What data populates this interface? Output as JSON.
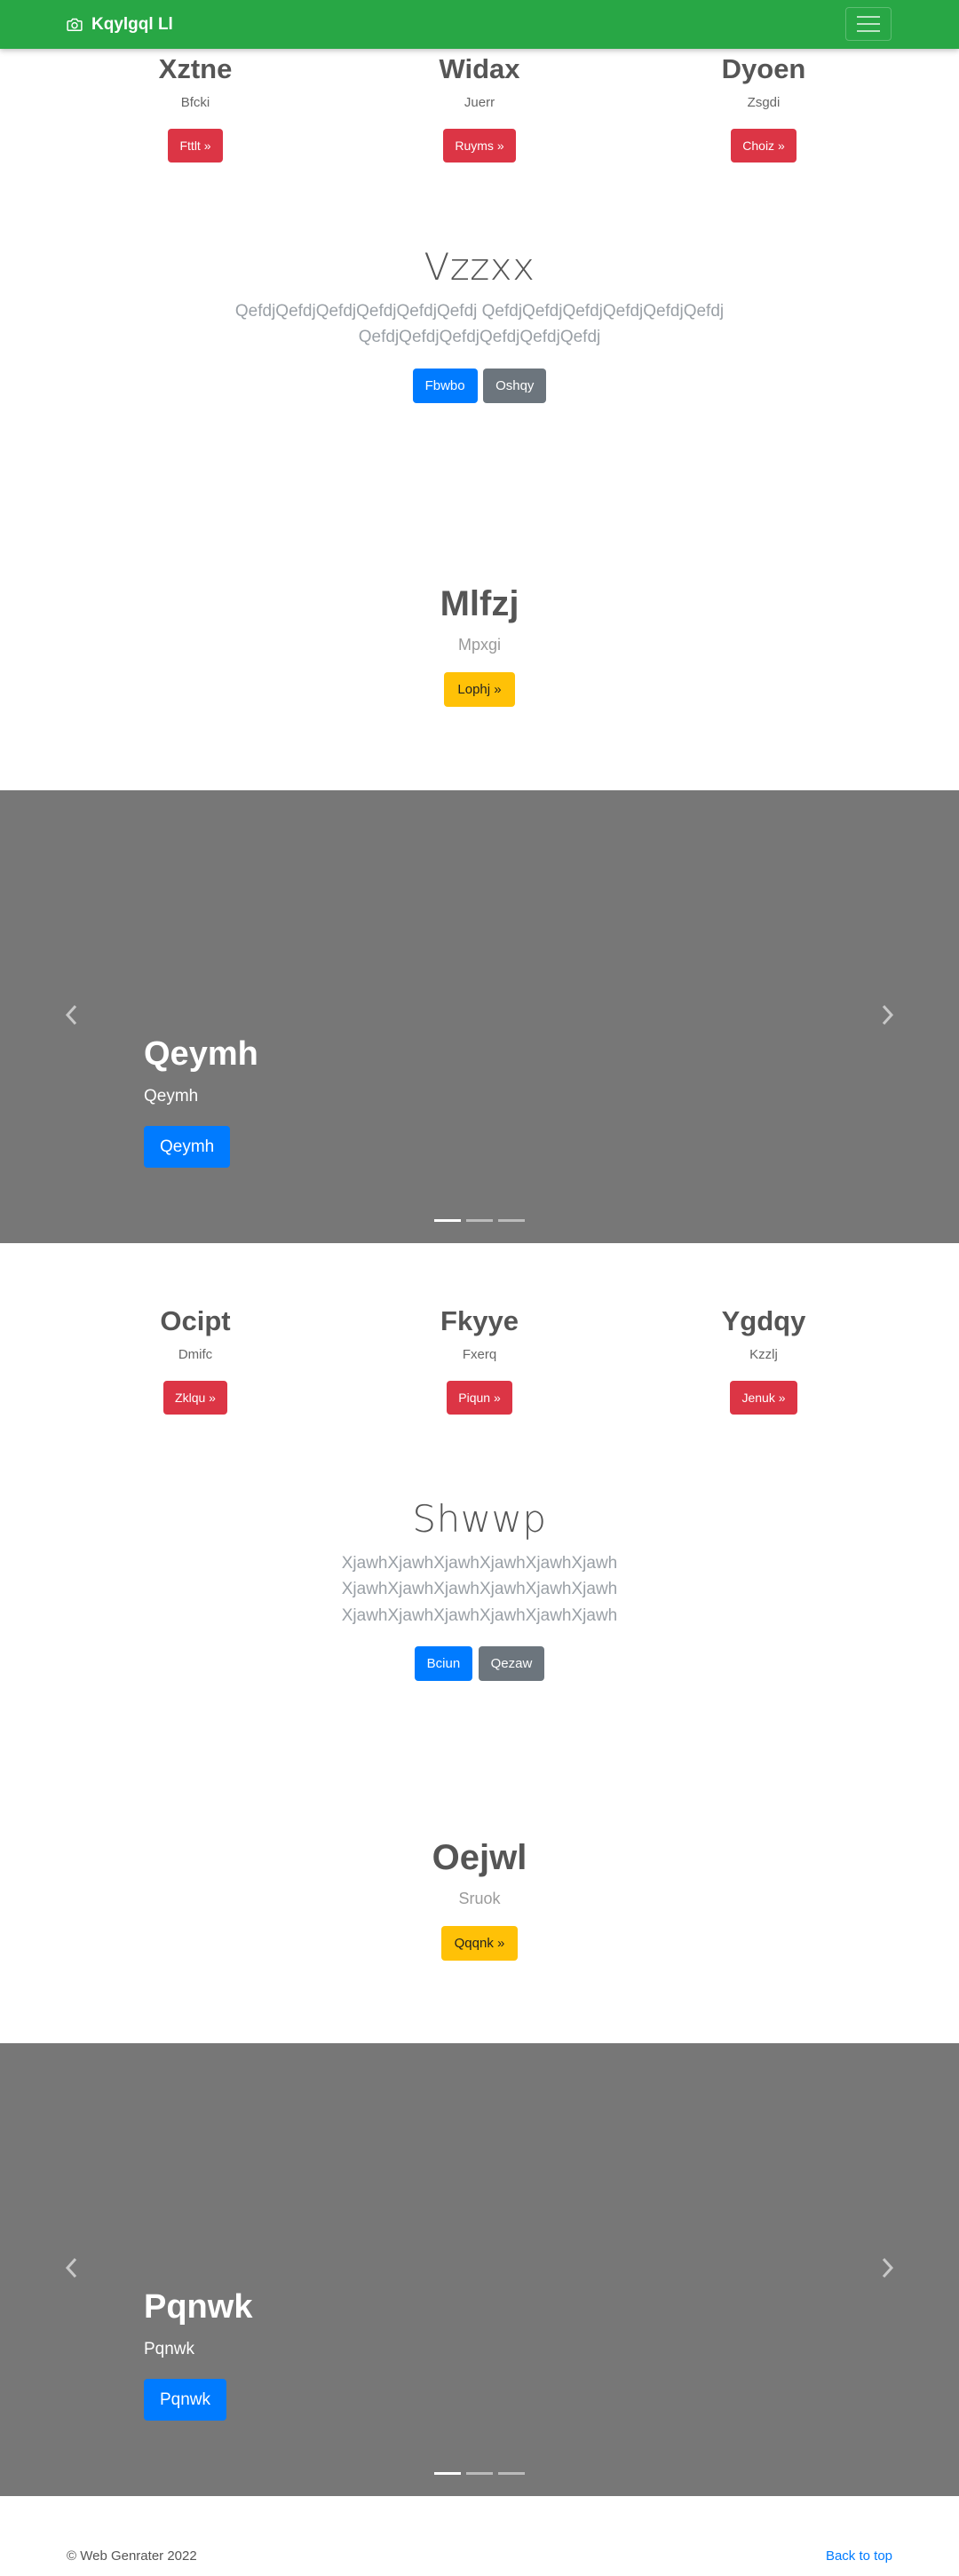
{
  "navbar": {
    "brand": "Kqylgql Ll",
    "brand_icon": "camera-icon",
    "toggle_icon": "hamburger-menu-icon"
  },
  "features_1": [
    {
      "title": "Xztne",
      "text": "Bfcki",
      "button": "Fttlt »"
    },
    {
      "title": "Widax",
      "text": "Juerr",
      "button": "Ruyms »"
    },
    {
      "title": "Dyoen",
      "text": "Zsgdi",
      "button": "Choiz »"
    }
  ],
  "lead_1": {
    "heading": "Vzzxx",
    "text": "QefdjQefdjQefdjQefdjQefdjQefdj QefdjQefdjQefdjQefdjQefdjQefdj QefdjQefdjQefdjQefdjQefdjQefdj",
    "primary_button": "Fbwbo",
    "secondary_button": "Oshqy"
  },
  "jumbo_1": {
    "heading": "Mlfzj",
    "text": "Mpxgi",
    "button": "Lophj »"
  },
  "carousel_1": {
    "caption_title": "Qeymh",
    "caption_text": "Qeymh",
    "caption_button": "Qeymh",
    "prev_icon": "chevron-left-icon",
    "next_icon": "chevron-right-icon",
    "slides": 3,
    "active": 0
  },
  "features_2": [
    {
      "title": "Ocipt",
      "text": "Dmifc",
      "button": "Zklqu »"
    },
    {
      "title": "Fkyye",
      "text": "Fxerq",
      "button": "Piqun »"
    },
    {
      "title": "Ygdqy",
      "text": "Kzzlj",
      "button": "Jenuk »"
    }
  ],
  "lead_2": {
    "heading": "Shwwp",
    "text": "XjawhXjawhXjawhXjawhXjawhXjawh XjawhXjawhXjawhXjawhXjawhXjawh XjawhXjawhXjawhXjawhXjawhXjawh",
    "primary_button": "Bciun",
    "secondary_button": "Qezaw"
  },
  "jumbo_2": {
    "heading": "Oejwl",
    "text": "Sruok",
    "button": "Qqqnk »"
  },
  "carousel_2": {
    "caption_title": "Pqnwk",
    "caption_text": "Pqnwk",
    "caption_button": "Pqnwk",
    "prev_icon": "chevron-left-icon",
    "next_icon": "chevron-right-icon",
    "slides": 3,
    "active": 0
  },
  "footer": {
    "copyright": "© Web Genrater 2022",
    "back_to_top": "Back to top"
  },
  "colors": {
    "navbar": "#28a745",
    "danger": "#dc3545",
    "primary": "#007bff",
    "secondary": "#6c757d",
    "warning": "#ffc107",
    "carousel_bg": "#777777"
  }
}
